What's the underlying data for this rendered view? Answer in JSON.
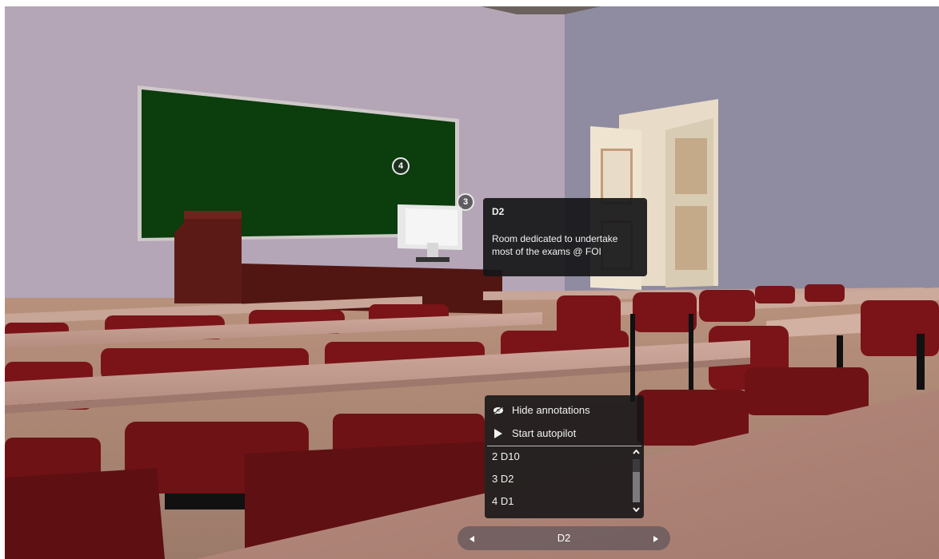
{
  "hotspots": [
    {
      "number": "4"
    },
    {
      "number": "3"
    }
  ],
  "tooltip": {
    "title": "D2",
    "description": "Room dedicated to undertake most of the exams @ FOI"
  },
  "menu": {
    "hide_annotations": {
      "label": "Hide annotations",
      "icon": "eye-slash-icon"
    },
    "start_autopilot": {
      "label": "Start autopilot",
      "icon": "play-icon"
    },
    "annotations": [
      {
        "label": "2 D10"
      },
      {
        "label": "3 D2"
      },
      {
        "label": "4 D1"
      }
    ]
  },
  "navigator": {
    "current": "D2",
    "prev_icon": "triangle-left-icon",
    "next_icon": "triangle-right-icon"
  },
  "colors": {
    "back_wall": "#b4a6b6",
    "side_wall": "#8d899e",
    "chalkboard": "#0b3d0d",
    "chair_red": "#7a1418",
    "desk_wood": "#c19a8e",
    "overlay_dark": "#161618"
  }
}
